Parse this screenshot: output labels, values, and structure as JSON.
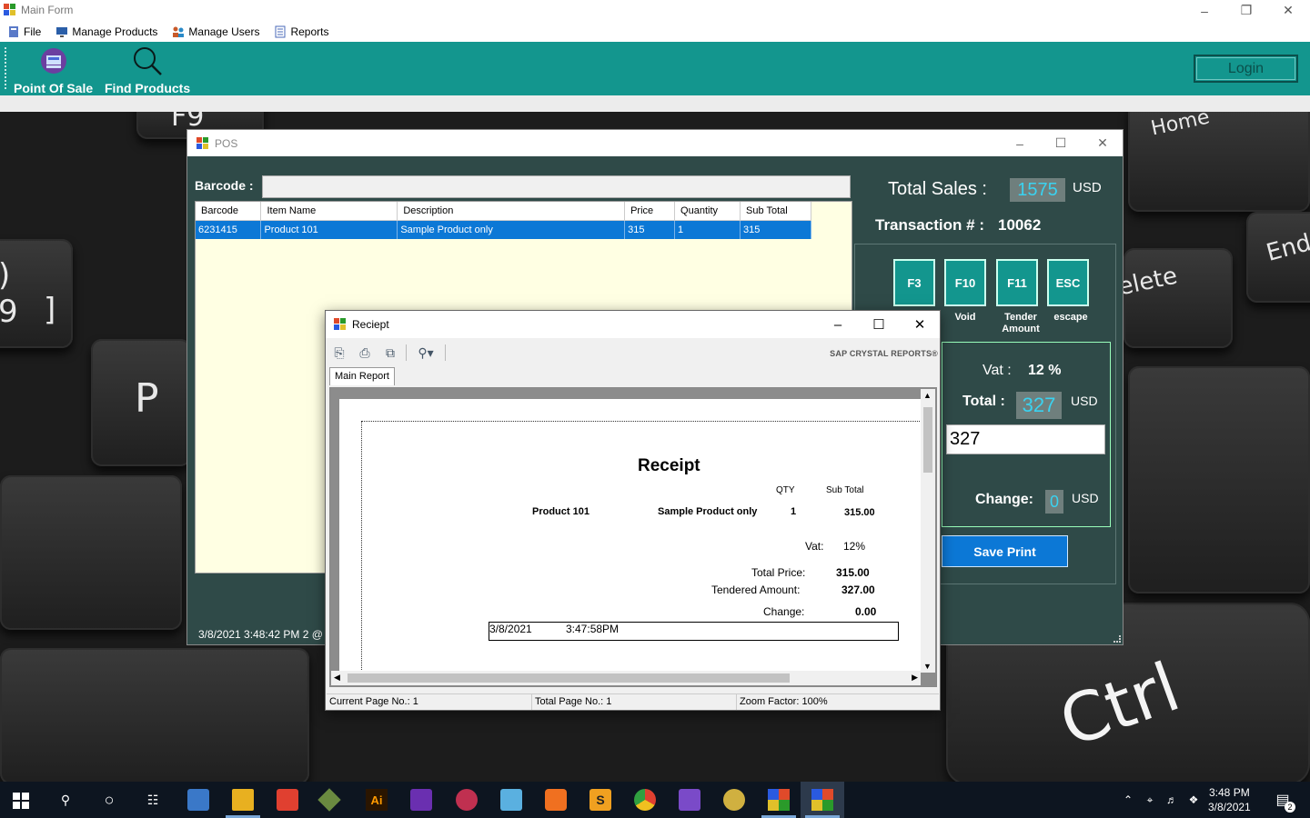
{
  "main_window": {
    "title": "Main Form",
    "menu": [
      "File",
      "Manage Products",
      "Manage Users",
      "Reports"
    ],
    "toolbar": {
      "pos_label": "Point Of Sale",
      "find_label": "Find Products",
      "login_label": "Login"
    }
  },
  "pos_window": {
    "title": "POS",
    "barcode_label": "Barcode :",
    "barcode_value": "",
    "grid": {
      "headers": [
        "Barcode",
        "Item Name",
        "Description",
        "Price",
        "Quantity",
        "Sub Total"
      ],
      "rows": [
        [
          "6231415",
          "Product 101",
          "Sample Product only",
          "315",
          "1",
          "315"
        ]
      ]
    },
    "total_sales_label": "Total Sales :",
    "total_sales_value": "1575",
    "currency": "USD",
    "transaction_label": "Transaction # :",
    "transaction_value": "10062",
    "function_keys": [
      {
        "key": "F3",
        "caption": ""
      },
      {
        "key": "F10",
        "caption": "Void"
      },
      {
        "key": "F11",
        "caption": "Tender Amount"
      },
      {
        "key": "ESC",
        "caption": "escape"
      }
    ],
    "vat_label": "Vat :",
    "vat_value": "12 %",
    "total_label": "Total :",
    "total_value": "327",
    "tender_input": "327",
    "change_label": "Change:",
    "change_value": "0",
    "save_print_label": "Save Print",
    "status_text": "3/8/2021 3:48:42 PM  2   @"
  },
  "receipt_window": {
    "title": "Reciept",
    "brand": "SAP CRYSTAL REPORTS®",
    "tab": "Main Report",
    "report": {
      "heading": "Receipt",
      "col_qty": "QTY",
      "col_subtotal": "Sub Total",
      "item_name": "Product 101",
      "item_desc": "Sample Product only",
      "item_qty": "1",
      "item_subtotal": "315.00",
      "vat_label": "Vat:",
      "vat_value": "12%",
      "total_price_label": "Total Price:",
      "total_price_value": "315.00",
      "tendered_label": "Tendered Amount:",
      "tendered_value": "327.00",
      "change_label": "Change:",
      "change_value": "0.00",
      "footer_date": "3/8/2021",
      "footer_time": "3:47:58PM"
    },
    "status": {
      "current_page": "Current Page No.: 1",
      "total_page": "Total Page No.: 1",
      "zoom": "Zoom Factor: 100%"
    }
  },
  "desktop_keys": [
    "F9",
    "Home",
    "End",
    "elete",
    "P",
    "Ctrl",
    ")",
    "9",
    "]"
  ],
  "taskbar": {
    "time": "3:48 PM",
    "date": "3/8/2021",
    "notification_count": "2"
  },
  "colors": {
    "teal": "#13968e",
    "pos_bg": "#2f4a48",
    "selection_blue": "#0c78d6",
    "value_cyan": "#3ad2f0"
  }
}
